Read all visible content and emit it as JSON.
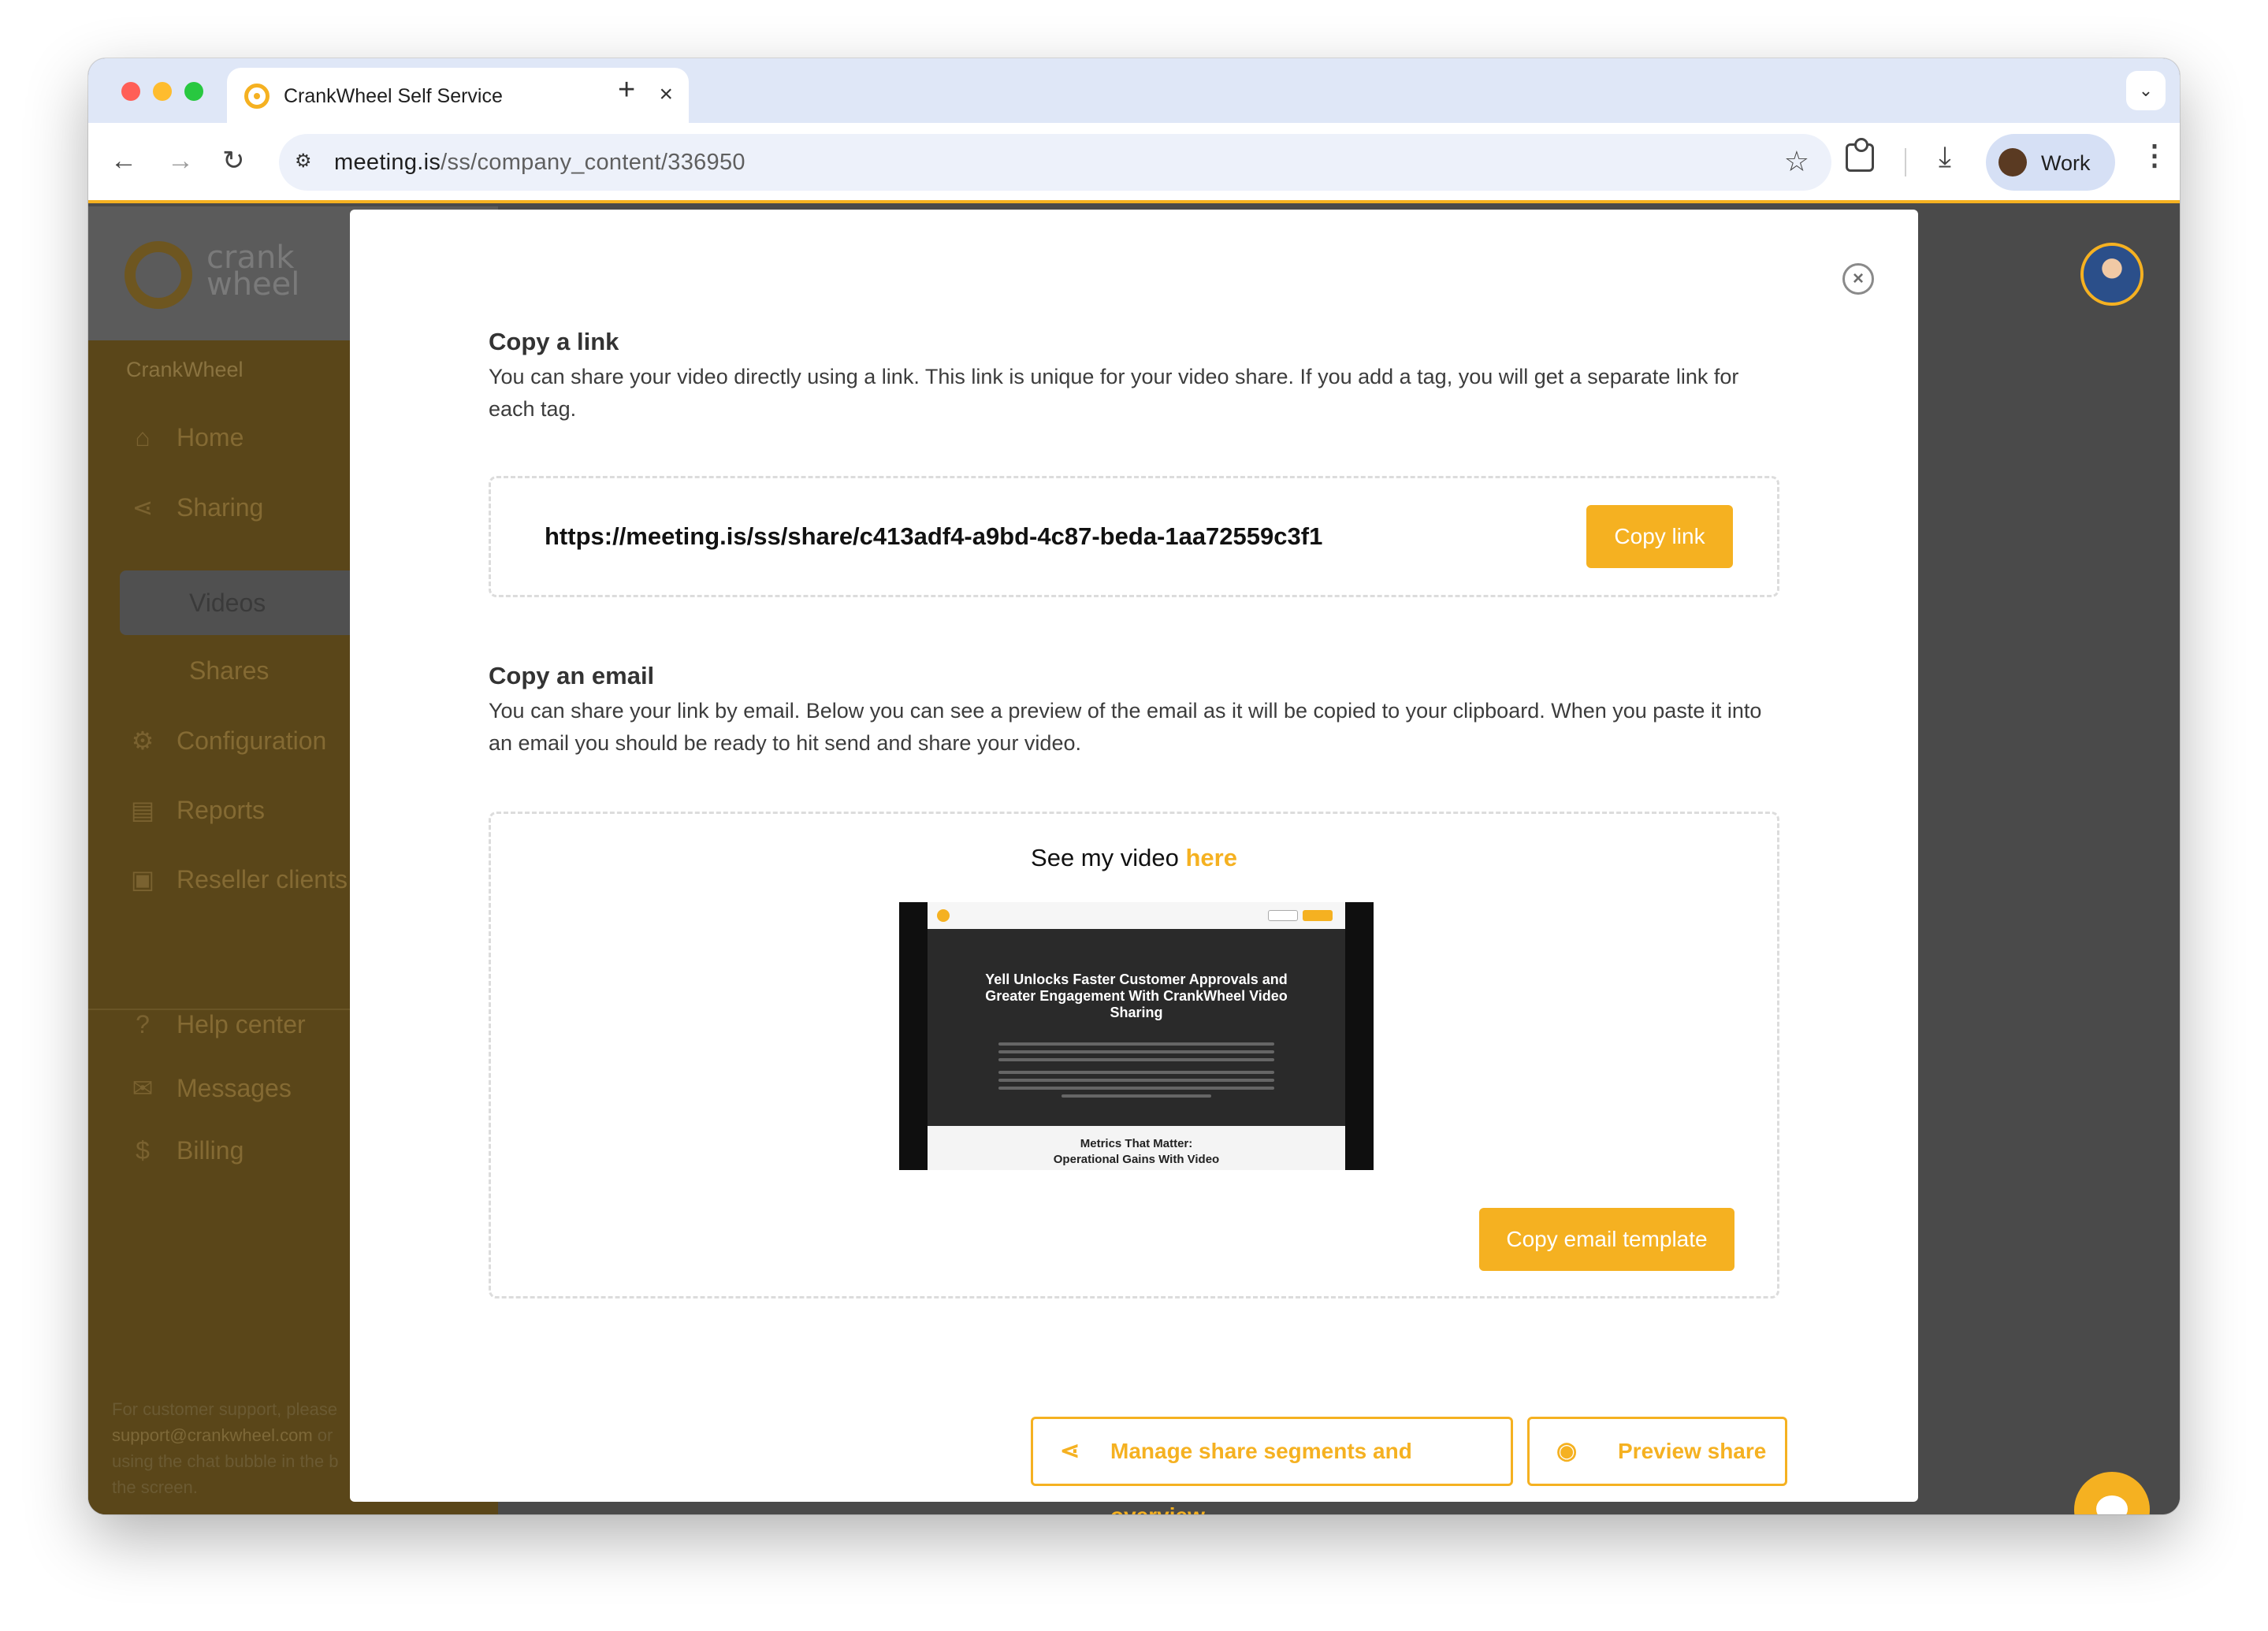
{
  "browser": {
    "tab_title": "CrankWheel Self Service",
    "tab_close": "×",
    "new_tab": "+",
    "url_host": "meeting.is",
    "url_path": "/ss/company_content/336950",
    "profile_label": "Work"
  },
  "sidebar": {
    "logo_line1": "crank",
    "logo_line2": "wheel",
    "company": "CrankWheel",
    "items": [
      {
        "label": "Home",
        "icon": "home-icon"
      },
      {
        "label": "Sharing",
        "icon": "share-icon"
      },
      {
        "label": "Videos",
        "icon": ""
      },
      {
        "label": "Shares",
        "icon": ""
      },
      {
        "label": "Configuration",
        "icon": "gear-icon"
      },
      {
        "label": "Reports",
        "icon": "report-icon"
      },
      {
        "label": "Reseller clients",
        "icon": "briefcase-icon"
      }
    ],
    "help_items": [
      {
        "label": "Help center",
        "icon": "help-icon"
      },
      {
        "label": "Messages",
        "icon": "mail-icon"
      },
      {
        "label": "Billing",
        "icon": "dollar-icon"
      }
    ],
    "footer_text_1": "For customer support, please",
    "footer_link": "support@crankwheel.com",
    "footer_text_2": "or",
    "footer_text_3": "using the chat bubble in the b",
    "footer_text_4": "the screen."
  },
  "modal": {
    "link_section": {
      "title": "Copy a link",
      "description": "You can share your video directly using a link. This link is unique for your video share. If you add a tag, you will get a separate link for each tag.",
      "link": "https://meeting.is/ss/share/c413adf4-a9bd-4c87-beda-1aa72559c3f1",
      "button": "Copy link"
    },
    "email_section": {
      "title": "Copy an email",
      "description": "You can share your link by email. Below you can see a preview of the email as it will be copied to your clipboard. When you paste it into an email you should be ready to hit send and share your video.",
      "preview_text": "See my video",
      "preview_link": "here",
      "thumbnail": {
        "headline": "Yell Unlocks Faster Customer Approvals and Greater Engagement With CrankWheel Video Sharing",
        "section_heading_1": "Metrics That Matter:",
        "section_heading_2": "Operational Gains With Video"
      },
      "button": "Copy email template"
    },
    "footer_buttons": {
      "manage": "Manage share segments and overview",
      "preview": "Preview share"
    }
  },
  "colors": {
    "accent": "#f5b121",
    "overlay": "#4a4a4a"
  }
}
